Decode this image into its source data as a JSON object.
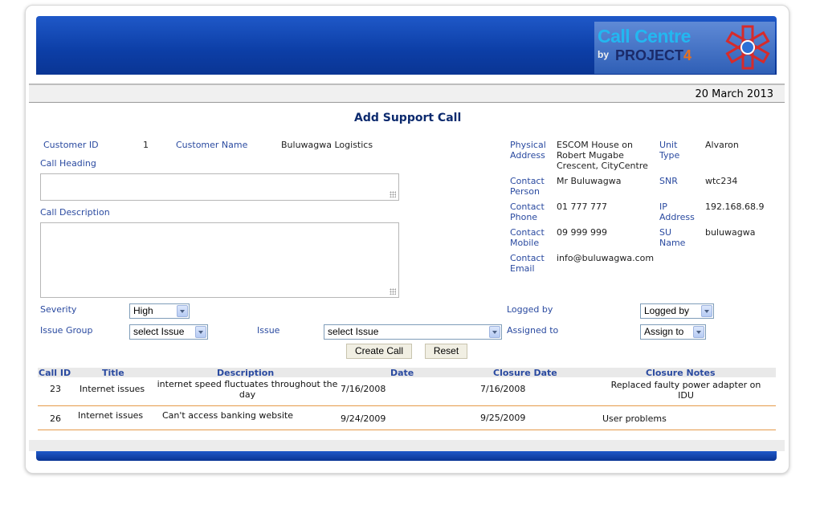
{
  "header": {
    "logo_line1": "Call Centre",
    "logo_by": "by",
    "logo_project": "PROJECT",
    "logo_number": "4",
    "date": "20 March 2013"
  },
  "form": {
    "title": "Add Support Call",
    "customer_id_label": "Customer ID",
    "customer_id": "1",
    "customer_name_label": "Customer Name",
    "customer_name": "Buluwagwa Logistics",
    "call_heading_label": "Call Heading",
    "call_description_label": "Call Description",
    "severity_label": "Severity",
    "severity_value": "High",
    "issue_group_label": "Issue Group",
    "issue_group_value": "select Issue",
    "issue_label": "Issue",
    "issue_value": "select Issue",
    "logged_by_label": "Logged by",
    "logged_by_value": "Logged by",
    "assigned_to_label": "Assigned to",
    "assigned_to_value": "Assign to",
    "create_button": "Create Call",
    "reset_button": "Reset"
  },
  "customer_info": {
    "physical_address_label_1": "Physical",
    "physical_address_label_2": "Address",
    "address_1": "ESCOM House on",
    "address_2": "Robert Mugabe",
    "address_3": "Crescent, CityCentre",
    "contact_person_label_1": "Contact",
    "contact_person_label_2": "Person",
    "contact_person": "Mr Buluwagwa",
    "contact_phone_label_1": "Contact",
    "contact_phone_label_2": "Phone",
    "contact_phone": "01 777 777",
    "contact_mobile_label_1": "Contact",
    "contact_mobile_label_2": "Mobile",
    "contact_mobile": "09 999 999",
    "contact_email_label_1": "Contact",
    "contact_email_label_2": "Email",
    "contact_email": "info@buluwagwa.com",
    "unit_type_label_1": "Unit",
    "unit_type_label_2": "Type",
    "unit_type": "Alvaron",
    "snr_label": "SNR",
    "snr": "wtc234",
    "ip_label_1": "IP",
    "ip_label_2": "Address",
    "ip": "192.168.68.9",
    "su_label_1": "SU",
    "su_label_2": "Name",
    "su_name": "buluwagwa"
  },
  "table": {
    "headers": [
      "Call ID",
      "Title",
      "Description",
      "Date",
      "Closure Date",
      "Closure Notes"
    ],
    "rows": [
      {
        "id": "23",
        "title": "Internet issues",
        "desc_1": "internet speed fluctuates throughout the",
        "desc_2": "day",
        "date": "7/16/2008",
        "closure_date": "7/16/2008",
        "notes_1": "Replaced faulty power adapter on",
        "notes_2": "IDU"
      },
      {
        "id": "26",
        "title": "Internet issues",
        "desc_1": "Can't access banking website",
        "desc_2": "",
        "date": "9/24/2009",
        "closure_date": "9/25/2009",
        "notes_1": "User problems",
        "notes_2": ""
      }
    ]
  },
  "colors": {
    "banner_blue": "#0c3ea6",
    "label_blue": "#2a4aa0",
    "row_divider": "#e59a4a",
    "logo_cyan": "#23b7f0",
    "logo_orange": "#e8701e"
  }
}
